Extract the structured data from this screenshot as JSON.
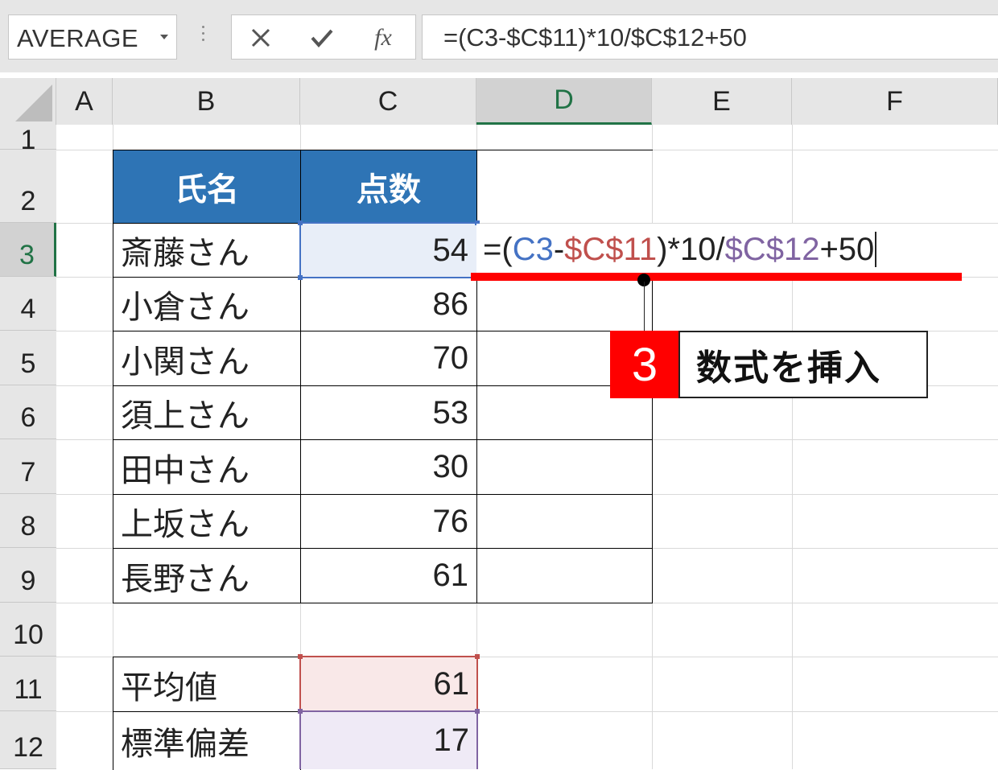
{
  "formula_bar": {
    "name_box": "AVERAGE",
    "cancel_icon": "x-icon",
    "enter_icon": "check-icon",
    "function_label": "fx",
    "formula": "=(C3-$C$11)*10/$C$12+50"
  },
  "columns": [
    "A",
    "B",
    "C",
    "D",
    "E",
    "F"
  ],
  "rows": [
    "1",
    "2",
    "3",
    "4",
    "5",
    "6",
    "7",
    "8",
    "9",
    "10",
    "11",
    "12"
  ],
  "selected_column": "D",
  "selected_row": "3",
  "table": {
    "headers": [
      "氏名",
      "点数"
    ],
    "rows": [
      {
        "name": "斎藤さん",
        "score": "54"
      },
      {
        "name": "小倉さん",
        "score": "86"
      },
      {
        "name": "小関さん",
        "score": "70"
      },
      {
        "name": "須上さん",
        "score": "53"
      },
      {
        "name": "田中さん",
        "score": "30"
      },
      {
        "name": "上坂さん",
        "score": "76"
      },
      {
        "name": "長野さん",
        "score": "61"
      }
    ]
  },
  "stats": [
    {
      "label": "平均値",
      "value": "61"
    },
    {
      "label": "標準偏差",
      "value": "17"
    }
  ],
  "editing_cell": {
    "parts": [
      "=(",
      "C3",
      "-",
      "$C$11",
      ")*10/",
      "$C$12",
      "+50"
    ]
  },
  "colors": {
    "header_fill": "#2e74b5",
    "ref_c3": "#4472c4",
    "ref_c11": "#c0504d",
    "ref_c12": "#8064a2",
    "callout_red": "#ff0000",
    "selection_green": "#217346"
  },
  "callout": {
    "number": "3",
    "label": "数式を挿入"
  }
}
